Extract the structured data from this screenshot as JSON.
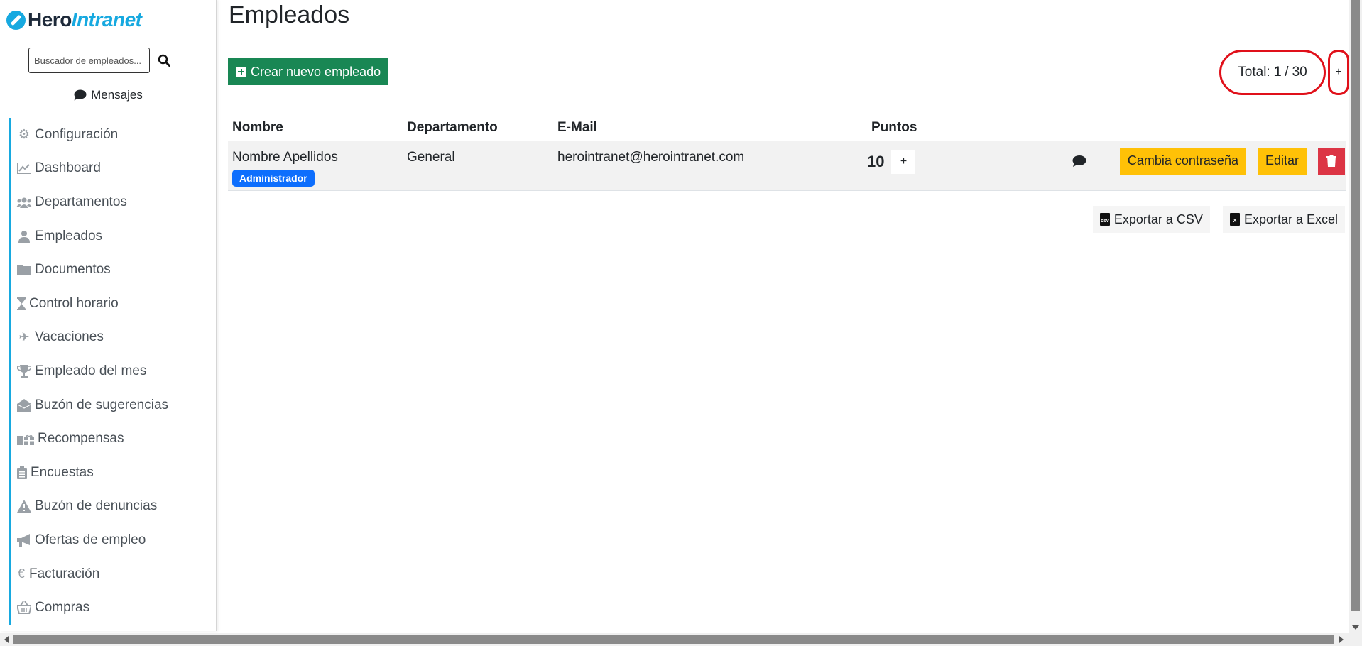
{
  "sidebar": {
    "logo": {
      "hero": "Hero",
      "intranet": "Intranet"
    },
    "search": {
      "placeholder": "Buscador de empleados..."
    },
    "messages_label": "Mensajes",
    "items": [
      {
        "label": "Configuración",
        "icon": "gear-icon"
      },
      {
        "label": "Dashboard",
        "icon": "chart-line-icon"
      },
      {
        "label": "Departamentos",
        "icon": "users-icon"
      },
      {
        "label": "Empleados",
        "icon": "user-icon"
      },
      {
        "label": "Documentos",
        "icon": "folder-icon"
      },
      {
        "label": "Control horario",
        "icon": "hourglass-icon"
      },
      {
        "label": "Vacaciones",
        "icon": "plane-icon"
      },
      {
        "label": "Empleado del mes",
        "icon": "trophy-icon"
      },
      {
        "label": "Buzón de sugerencias",
        "icon": "envelope-open-icon"
      },
      {
        "label": "Recompensas",
        "icon": "gifts-icon"
      },
      {
        "label": "Encuestas",
        "icon": "clipboard-list-icon"
      },
      {
        "label": "Buzón de denuncias",
        "icon": "warning-icon"
      },
      {
        "label": "Ofertas de empleo",
        "icon": "megaphone-icon"
      },
      {
        "label": "Facturación",
        "icon": "euro-icon"
      },
      {
        "label": "Compras",
        "icon": "basket-icon"
      }
    ]
  },
  "main": {
    "title": "Empleados",
    "create_button": "Crear nuevo empleado",
    "total": {
      "label": "Total:",
      "current": "1",
      "separator": "/",
      "max": "30"
    },
    "add_more_label": "+",
    "table": {
      "headers": [
        "Nombre",
        "Departamento",
        "E-Mail",
        "Puntos"
      ],
      "rows": [
        {
          "name": "Nombre Apellidos",
          "role_badge": "Administrador",
          "department": "General",
          "email": "herointranet@herointranet.com",
          "points": "10",
          "points_add": "+",
          "change_password": "Cambia contraseña",
          "edit": "Editar"
        }
      ]
    },
    "export_csv": "Exportar a CSV",
    "export_excel": "Exportar a Excel"
  },
  "colors": {
    "accent": "#17a9e0",
    "create": "#198754",
    "badge": "#0d6efd",
    "warning": "#ffc107",
    "danger": "#dc3545",
    "highlight_circle": "#e0101a"
  }
}
